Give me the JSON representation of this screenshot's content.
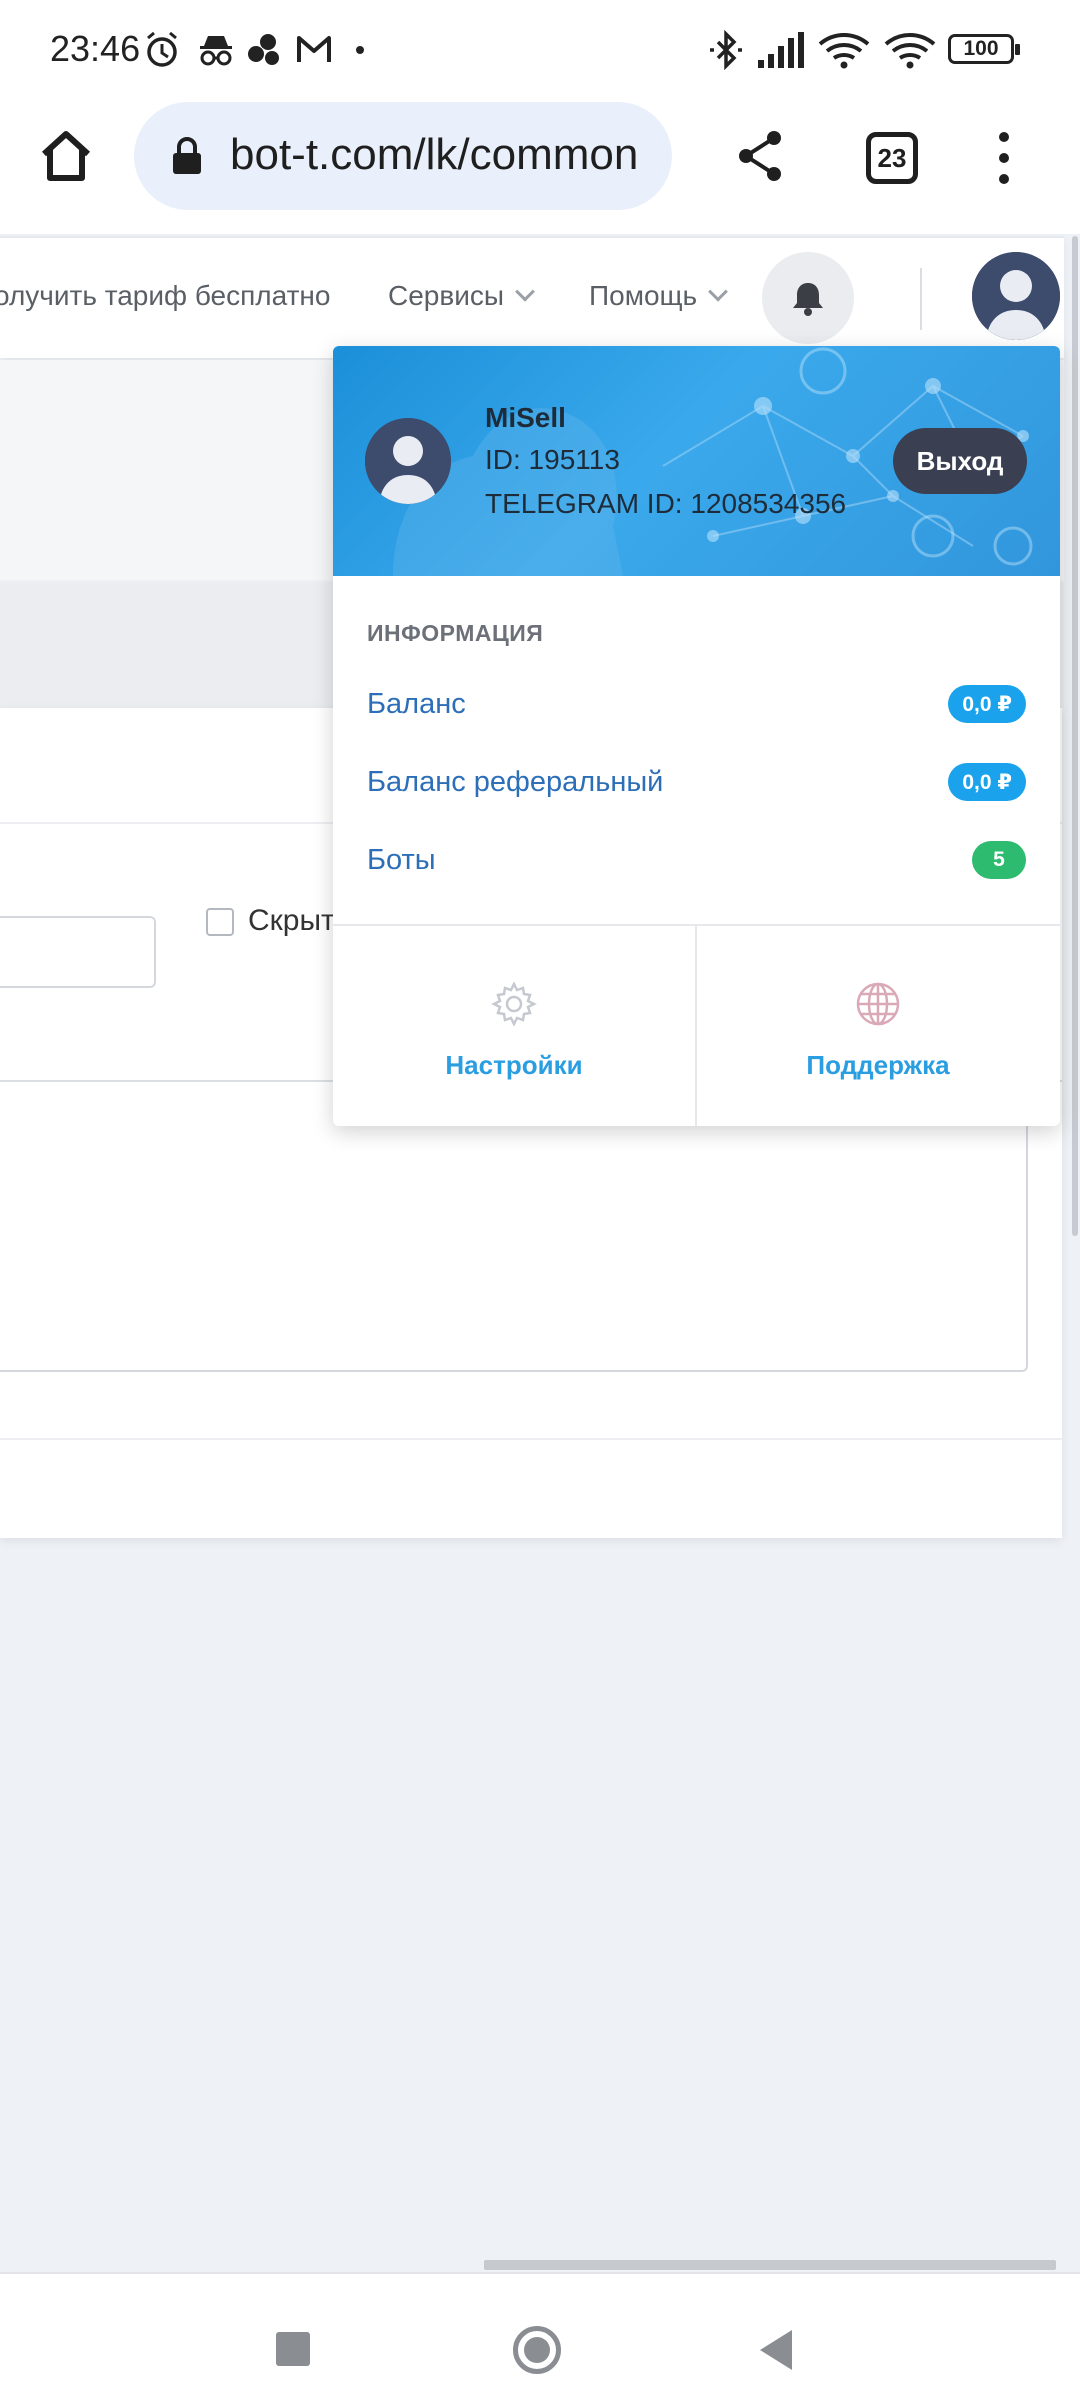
{
  "status_bar": {
    "time": "23:46",
    "battery": "100",
    "icons": [
      "alarm-icon",
      "incognito-icon",
      "app-icon",
      "gmail-icon",
      "dot-icon",
      "bluetooth-icon",
      "signal-icon",
      "wifi-icon",
      "wifi-icon"
    ]
  },
  "browser": {
    "url": "bot-t.com/lk/common",
    "tab_count": "23",
    "icons": [
      "home-icon",
      "lock-icon",
      "share-icon",
      "more-vert-icon"
    ]
  },
  "site_nav": {
    "items": [
      {
        "label": "олучить тариф бесплатно"
      },
      {
        "label": "Сервисы"
      },
      {
        "label": "Помощь"
      }
    ],
    "icons": [
      "bell-icon",
      "avatar"
    ]
  },
  "page": {
    "checkbox_label": "Скрыт"
  },
  "profile_menu": {
    "name": "MiSell",
    "id": "ID: 195113",
    "telegram_id": "TELEGRAM ID: 1208534356",
    "logout": "Выход",
    "section_title": "ИНФОРМАЦИЯ",
    "rows": [
      {
        "label": "Баланс",
        "badge": "0,0 ₽",
        "badge_color": "#1aa3ec"
      },
      {
        "label": "Баланс реферальный",
        "badge": "0,0 ₽",
        "badge_color": "#1aa3ec"
      },
      {
        "label": "Боты",
        "badge": "5",
        "badge_color": "#2dbb6f"
      }
    ],
    "tiles": [
      {
        "label": "Настройки",
        "icon": "gear-icon"
      },
      {
        "label": "Поддержка",
        "icon": "globe-icon"
      }
    ]
  },
  "colors": {
    "header_blue": "#1b8fd8",
    "link_blue": "#2c6fb8",
    "tile_blue": "#2a9ee0",
    "logout_bg": "#3a3f52"
  }
}
